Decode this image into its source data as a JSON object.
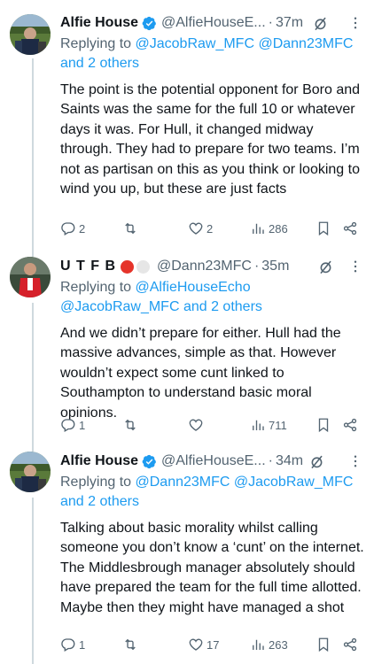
{
  "tweets": [
    {
      "name": "Alfie House",
      "handle": "@AlfieHouseE...",
      "time": "37m",
      "replying_prefix": "Replying to ",
      "replying_mentions": "@JacobRaw_MFC @Dann23MFC",
      "replying_suffix": "and 2 others",
      "text": "The point is the potential opponent for Boro and Saints was the same for the full 10 or whatever days it was. For Hull, it changed midway through. They had to prepare for two teams. I’m not as partisan on this as you think or looking to wind you up, but these are just facts",
      "replies": "2",
      "retweets": "",
      "likes": "2",
      "views": "286"
    },
    {
      "name": "U T F B",
      "handle": "@Dann23MFC",
      "time": "35m",
      "replying_prefix": "Replying to ",
      "replying_mentions": "@AlfieHouseEcho",
      "replying_suffix": "@JacobRaw_MFC and 2 others",
      "text": "And we didn’t prepare for either. Hull had the massive advances, simple as that. However wouldn’t expect some cunt linked to Southampton to understand basic moral opinions.",
      "replies": "1",
      "retweets": "",
      "likes": "",
      "views": "711"
    },
    {
      "name": "Alfie House",
      "handle": "@AlfieHouseE...",
      "time": "34m",
      "replying_prefix": "Replying to ",
      "replying_mentions": "@Dann23MFC @JacobRaw_MFC",
      "replying_suffix": "and 2 others",
      "text": "Talking about basic morality whilst calling someone you don’t know a ‘cunt’ on the internet. The Middlesbrough manager absolutely should have prepared the team for the full time allotted. Maybe then they might have managed a shot",
      "replies": "1",
      "retweets": "",
      "likes": "17",
      "views": "263"
    }
  ],
  "colors": {
    "text": "#0f1419",
    "secondary": "#536471",
    "link": "#1d9bf0",
    "verified": "#1d9bf0",
    "rail": "#cfd9de"
  }
}
